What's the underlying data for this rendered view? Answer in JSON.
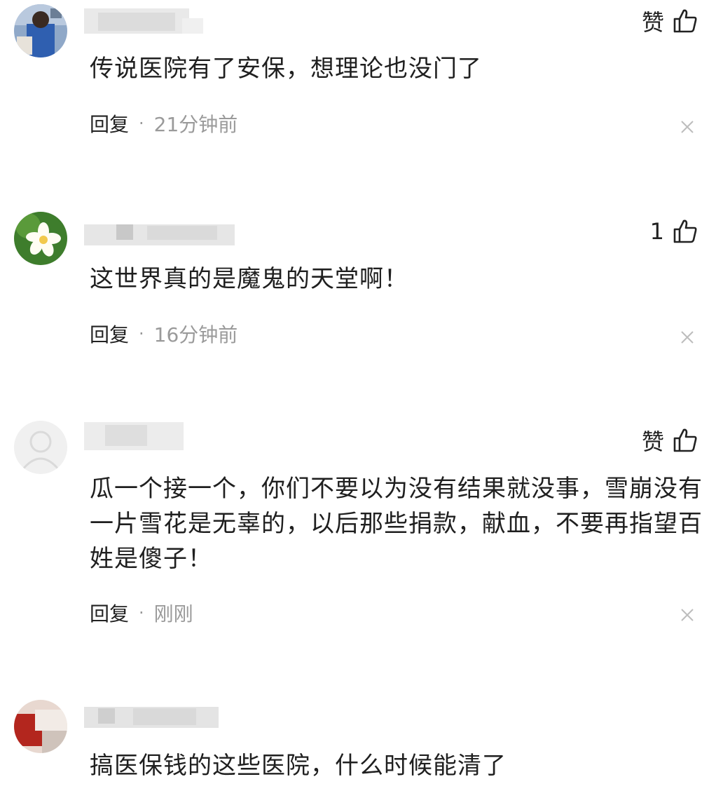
{
  "comments": [
    {
      "like_label": "赞",
      "text": "传说医院有了安保，想理论也没门了",
      "reply_label": "回复",
      "separator": "·",
      "time": "21分钟前"
    },
    {
      "like_label": "1",
      "text": "这世界真的是魔鬼的天堂啊！",
      "reply_label": "回复",
      "separator": "·",
      "time": "16分钟前"
    },
    {
      "like_label": "赞",
      "text": "瓜一个接一个，你们不要以为没有结果就没事，雪崩没有一片雪花是无辜的，以后那些捐款，献血，不要再指望百姓是傻子！",
      "reply_label": "回复",
      "separator": "·",
      "time": "刚刚"
    },
    {
      "text": "搞医保钱的这些医院，什么时候能清了"
    }
  ],
  "icons": {
    "like": "thumbs-up-icon",
    "close": "close-icon"
  }
}
